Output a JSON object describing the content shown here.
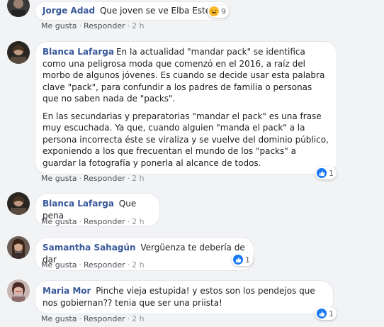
{
  "colors": {
    "author": "#385898",
    "like": "#1877f2",
    "meta": "#90949c",
    "bubble": "#ffffff"
  },
  "comments": [
    {
      "author": "Jorge Adad",
      "text": "Que joven se ve Elba Ester",
      "reaction": {
        "icon": "haha-emoji",
        "count": "9"
      },
      "actions": {
        "like": "Me gusta",
        "reply": "Responder",
        "time": "2 h"
      }
    },
    {
      "author": "Blanca Lafarga",
      "paragraphs": [
        "En la actualidad \"mandar pack\" se identifica como una peligrosa moda que comenzó en el 2016, a raíz del morbo de algunos jóvenes. Es cuando se decide usar esta palabra clave \"pack\", para confundir a los padres de familia o personas que no saben nada de \"packs\".",
        "En las secundarias y preparatorias \"mandar el pack\" es una frase muy escuchada. Ya que, cuando alguien \"manda el pack\" a la persona incorrecta éste se viraliza y se vuelve del dominio público, exponiendo a los que frecuentan el mundo de los \"packs\" a guardar la fotografía y ponerla al alcance de todos."
      ],
      "reaction": {
        "icon": "like-icon",
        "count": "1"
      },
      "actions": {
        "like": "Me gusta",
        "reply": "Responder",
        "time": "2 h"
      }
    },
    {
      "author": "Blanca Lafarga",
      "text": "Que pena",
      "actions": {
        "like": "Me gusta",
        "reply": "Responder",
        "time": "2 h"
      }
    },
    {
      "author": "Samantha Sahagún",
      "text": "Vergüenza te debería de dar",
      "reaction": {
        "icon": "like-icon",
        "count": "1"
      },
      "actions": {
        "like": "Me gusta",
        "reply": "Responder",
        "time": "2 h"
      }
    },
    {
      "author": "Maria Mor",
      "text": "Pinche vieja estupida! y estos son los pendejos que nos gobiernan?? tenia que ser una priista!",
      "reaction": {
        "icon": "like-icon",
        "count": "1"
      },
      "actions": {
        "like": "Me gusta",
        "reply": "Responder",
        "time": "2 h"
      }
    }
  ]
}
